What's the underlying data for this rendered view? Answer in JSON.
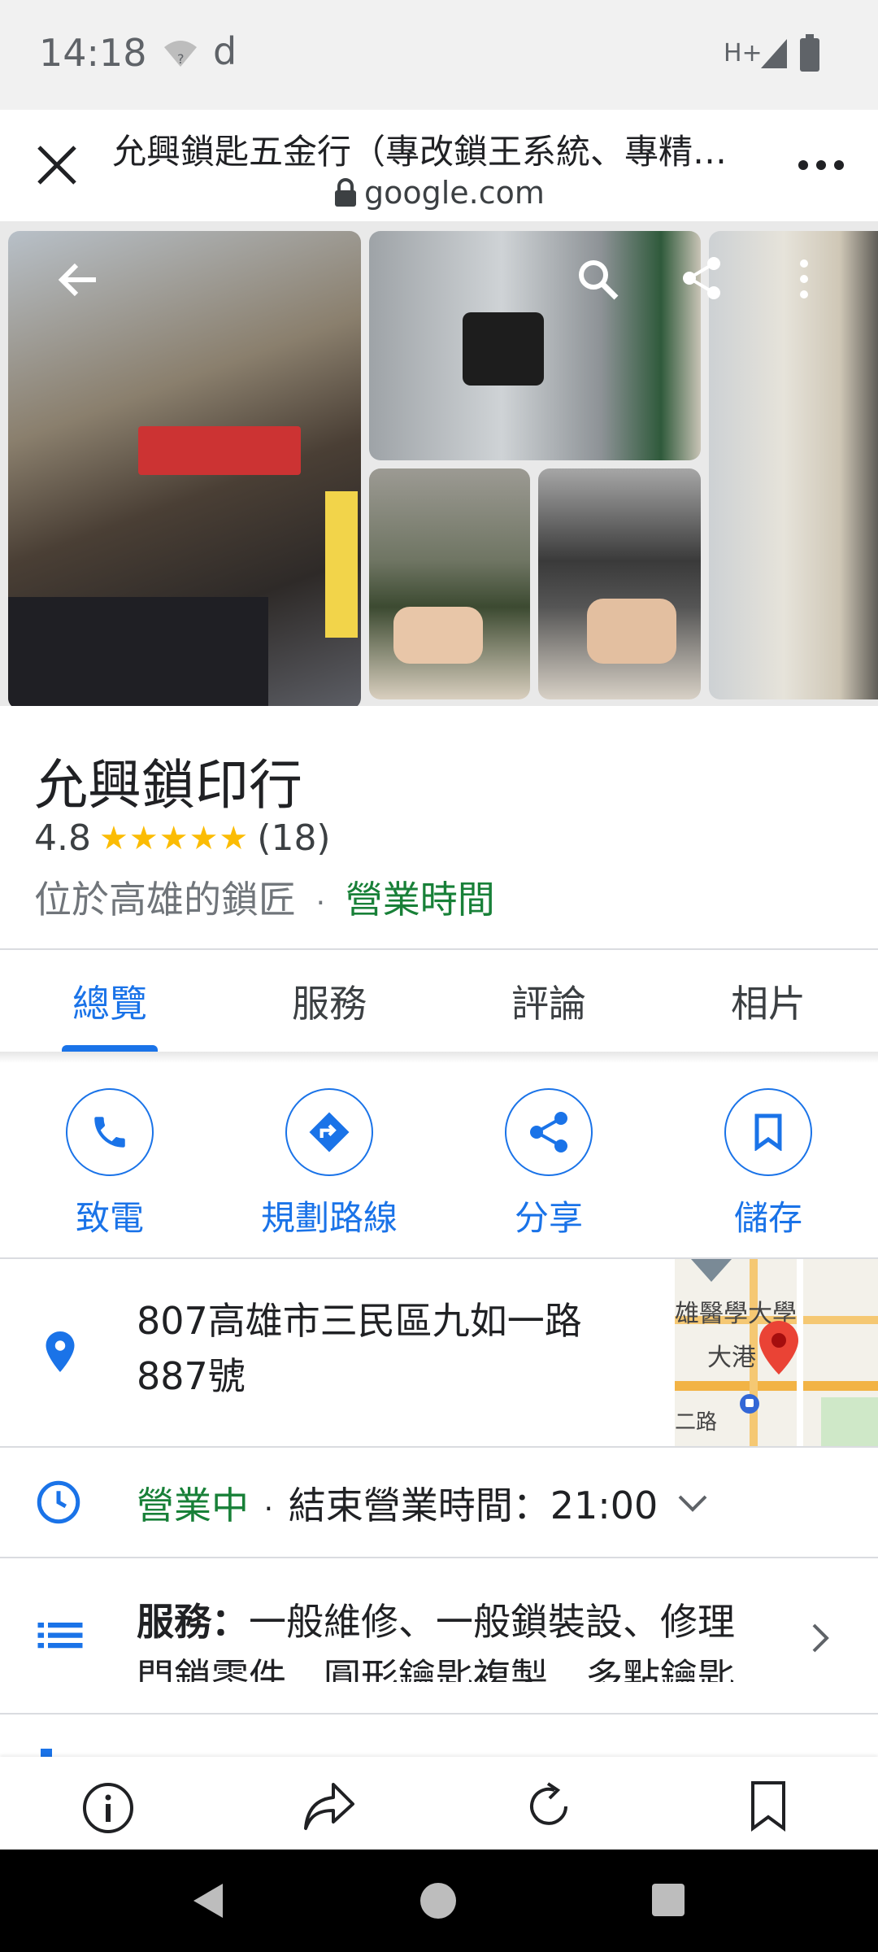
{
  "status_bar": {
    "time": "14:18",
    "carrier_letter": "d",
    "network": "H+"
  },
  "browser": {
    "page_title": "允興鎖匙五金行（專改鎖王系統、專精…",
    "url": "google.com"
  },
  "place": {
    "name": "允興鎖印行",
    "rating": "4.8",
    "stars": "★★★★★",
    "review_count": "(18)",
    "category": "位於高雄的鎖匠",
    "separator": "·",
    "hours_link": "營業時間"
  },
  "tabs": [
    {
      "label": "總覽",
      "active": true
    },
    {
      "label": "服務",
      "active": false
    },
    {
      "label": "評論",
      "active": false
    },
    {
      "label": "相片",
      "active": false
    }
  ],
  "actions": [
    {
      "label": "致電",
      "icon": "phone-icon"
    },
    {
      "label": "規劃路線",
      "icon": "directions-icon"
    },
    {
      "label": "分享",
      "icon": "share-icon"
    },
    {
      "label": "儲存",
      "icon": "bookmark-icon"
    }
  ],
  "address": {
    "line1": "807高雄市三民區九如一路",
    "line2": "887號"
  },
  "map_preview": {
    "label1": "雄醫學大學",
    "label2": "大港",
    "label3": "二路"
  },
  "hours": {
    "status": "營業中",
    "separator": "·",
    "closing": "結束營業時間：21:00"
  },
  "services": {
    "heading": "服務：",
    "line1": "一般維修、一般鎖裝設、修理",
    "line2": "門鎖零件、圓形鑰匙複製、多點鑰匙"
  },
  "colors": {
    "accent": "#1a73e8",
    "open_green": "#188038",
    "star": "#fbbc04"
  }
}
